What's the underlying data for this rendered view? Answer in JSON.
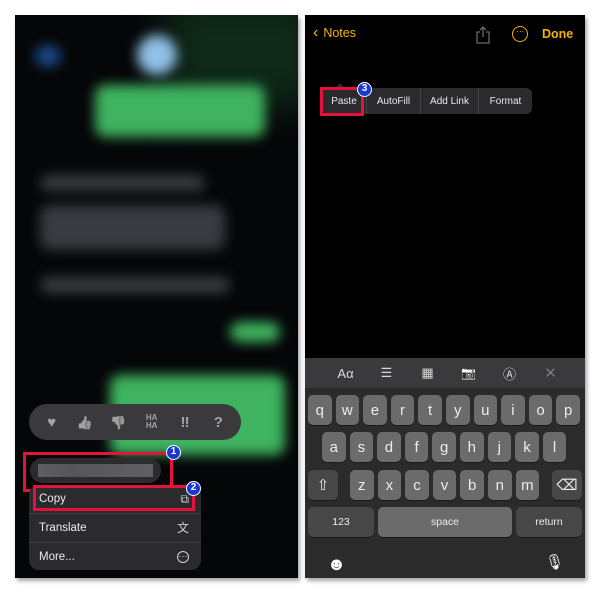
{
  "left_panel": {
    "reactions": [
      {
        "icon": "heart-icon",
        "glyph": "♥"
      },
      {
        "icon": "thumbs-up-icon",
        "glyph": "👍"
      },
      {
        "icon": "thumbs-down-icon",
        "glyph": "👎"
      },
      {
        "icon": "haha-icon",
        "glyph": "HA HA"
      },
      {
        "icon": "exclamation-icon",
        "glyph": "‼"
      },
      {
        "icon": "question-icon",
        "glyph": "?"
      }
    ],
    "context_menu": [
      {
        "label": "Copy",
        "icon": "copy-icon",
        "glyph": "⧉"
      },
      {
        "label": "Translate",
        "icon": "translate-icon",
        "glyph": "文"
      },
      {
        "label": "More...",
        "icon": "more-icon",
        "glyph": "⋯"
      }
    ],
    "step_badges": [
      "1",
      "2"
    ],
    "colors": {
      "highlight": "#e5123b",
      "badge": "#1b36d6",
      "bubble_green": "#3fb35f"
    }
  },
  "right_panel": {
    "nav": {
      "back_label": "Notes",
      "done_label": "Done",
      "accent": "#f2b400"
    },
    "edit_menu": [
      "Paste",
      "AutoFill",
      "Add Link",
      "Format"
    ],
    "step_badge": "3",
    "toolbar": [
      {
        "icon": "text-format-icon",
        "glyph": "Aα"
      },
      {
        "icon": "checklist-icon",
        "glyph": "☰"
      },
      {
        "icon": "table-icon",
        "glyph": "▦"
      },
      {
        "icon": "camera-icon",
        "glyph": "📷"
      },
      {
        "icon": "markup-icon",
        "glyph": "Ⓐ"
      },
      {
        "icon": "close-icon",
        "glyph": "✕"
      }
    ],
    "keyboard": {
      "row1": [
        "q",
        "w",
        "e",
        "r",
        "t",
        "y",
        "u",
        "i",
        "o",
        "p"
      ],
      "row2": [
        "a",
        "s",
        "d",
        "f",
        "g",
        "h",
        "j",
        "k",
        "l"
      ],
      "row3": [
        "z",
        "x",
        "c",
        "v",
        "b",
        "n",
        "m"
      ],
      "shift": "⇧",
      "delete": "⌫",
      "numbers": "123",
      "space": "space",
      "return": "return",
      "emoji": "☻",
      "mic": "🎙"
    }
  }
}
